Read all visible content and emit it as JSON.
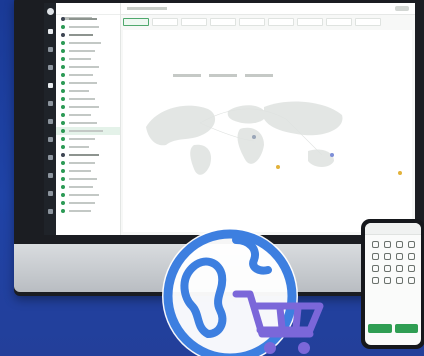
{
  "colors": {
    "background": "#1f43a6",
    "accent_green": "#2f8c45",
    "icon_blue": "#3d7fe0",
    "cart_purple": "#7b67d9"
  },
  "screen": {
    "app_title": "",
    "map_heading": "",
    "sidebar_items": [
      "",
      "",
      "",
      "",
      "",
      "",
      "",
      "",
      "",
      "",
      "",
      "",
      "",
      "",
      "",
      "",
      "",
      "",
      "",
      "",
      "",
      "",
      "",
      "",
      ""
    ],
    "tabs": [
      "",
      "",
      "",
      "",
      "",
      "",
      "",
      "",
      ""
    ]
  },
  "phone": {
    "action_buttons": [
      "",
      ""
    ]
  },
  "icons": {
    "hero": "globe-shopping-cart-icon"
  }
}
